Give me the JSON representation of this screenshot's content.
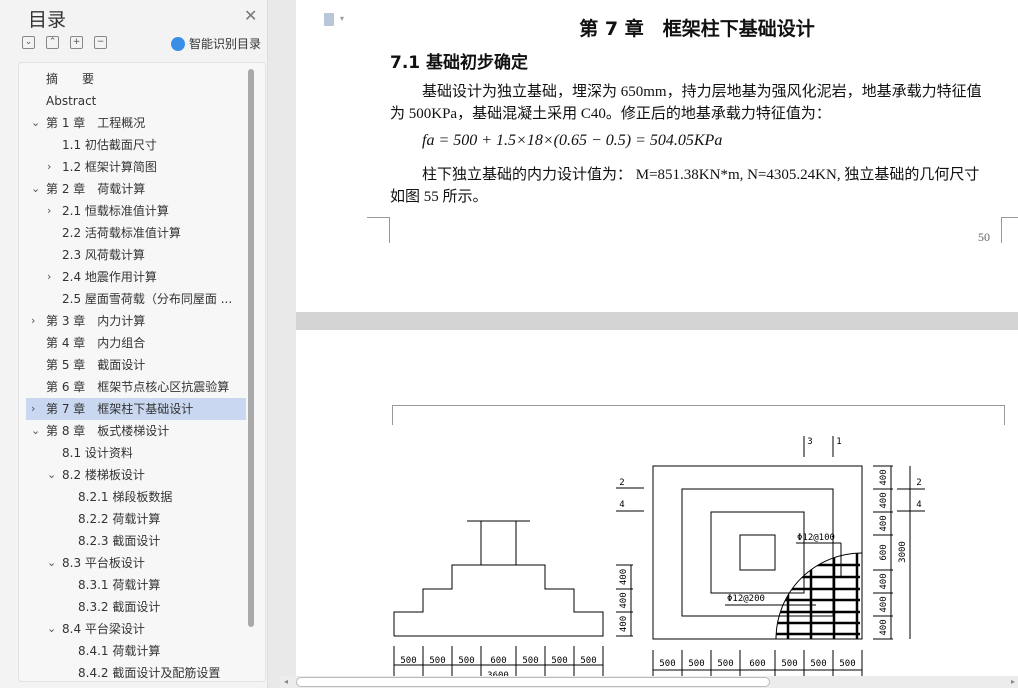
{
  "sidebar": {
    "title": "目录",
    "close": "✕",
    "tools": [
      {
        "icon": "collapse-all-icon",
        "glyph": "⌄"
      },
      {
        "icon": "expand-up-icon",
        "glyph": "⌃"
      },
      {
        "icon": "plus-icon",
        "glyph": "+"
      },
      {
        "icon": "minus-icon",
        "glyph": "−"
      }
    ],
    "smart_label": "智能识别目录",
    "items": [
      {
        "label": "摘　　要",
        "level": 0,
        "arrow": ""
      },
      {
        "label": "Abstract",
        "level": 0,
        "arrow": ""
      },
      {
        "label": "第 1 章　工程概况",
        "level": 0,
        "arrow": "⌄"
      },
      {
        "label": "1.1  初估截面尺寸",
        "level": 1,
        "arrow": ""
      },
      {
        "label": "1.2  框架计算简图",
        "level": 1,
        "arrow": "›"
      },
      {
        "label": "第 2 章　荷载计算",
        "level": 0,
        "arrow": "⌄"
      },
      {
        "label": "2.1  恒载标准值计算",
        "level": 1,
        "arrow": "›"
      },
      {
        "label": "2.2  活荷载标准值计算",
        "level": 1,
        "arrow": ""
      },
      {
        "label": "2.3  风荷载计算",
        "level": 1,
        "arrow": ""
      },
      {
        "label": "2.4 地震作用计算",
        "level": 1,
        "arrow": "›"
      },
      {
        "label": "2.5  屋面雪荷载（分布同屋面 ...",
        "level": 1,
        "arrow": ""
      },
      {
        "label": "第 3 章　内力计算",
        "level": 0,
        "arrow": "›"
      },
      {
        "label": "第 4 章　内力组合",
        "level": 0,
        "arrow": ""
      },
      {
        "label": "第 5 章　截面设计",
        "level": 0,
        "arrow": ""
      },
      {
        "label": "第 6 章　框架节点核心区抗震验算",
        "level": 0,
        "arrow": ""
      },
      {
        "label": "第 7 章　框架柱下基础设计",
        "level": 0,
        "arrow": "›",
        "selected": true
      },
      {
        "label": "第 8 章　板式楼梯设计",
        "level": 0,
        "arrow": "⌄"
      },
      {
        "label": "8.1 设计资料",
        "level": 1,
        "arrow": ""
      },
      {
        "label": "8.2 楼梯板设计",
        "level": 1,
        "arrow": "⌄"
      },
      {
        "label": "8.2.1 梯段板数据",
        "level": 2,
        "arrow": ""
      },
      {
        "label": "8.2.2 荷载计算",
        "level": 2,
        "arrow": ""
      },
      {
        "label": "8.2.3 截面设计",
        "level": 2,
        "arrow": ""
      },
      {
        "label": "8.3 平台板设计",
        "level": 1,
        "arrow": "⌄"
      },
      {
        "label": "8.3.1 荷载计算",
        "level": 2,
        "arrow": ""
      },
      {
        "label": "8.3.2 截面设计",
        "level": 2,
        "arrow": ""
      },
      {
        "label": "8.4 平台梁设计",
        "level": 1,
        "arrow": "⌄"
      },
      {
        "label": "8.4.1 荷载计算",
        "level": 2,
        "arrow": ""
      },
      {
        "label": "8.4.2 截面设计及配筋设置",
        "level": 2,
        "arrow": ""
      }
    ]
  },
  "document": {
    "chapter_title": "第 7 章　框架柱下基础设计",
    "section_title": "7.1  基础初步确定",
    "para1_line1": "基础设计为独立基础，埋深为 650mm，持力层地基为强风化泥岩，地基承载力特征值",
    "para1_line2": "为 500KPa，基础混凝土采用 C40。修正后的地基承载力特征值为：",
    "formula": "fa = 500 + 1.5×18×(0.65 − 0.5) = 504.05KPa",
    "para2_line1": "柱下独立基础的内力设计值为： M=851.38KN*m, N=4305.24KN, 独立基础的几何尺寸",
    "para2_line2": "如图 55 所示。",
    "page_number": "50"
  },
  "drawing": {
    "elev_widths": [
      "500",
      "500",
      "500",
      "600",
      "500",
      "500",
      "500"
    ],
    "elev_total": "3600",
    "elev_heights": [
      "400",
      "400",
      "400"
    ],
    "plan_widths": [
      "500",
      "500",
      "500",
      "600",
      "500",
      "500",
      "500"
    ],
    "plan_heights": [
      "400",
      "400",
      "400",
      "600",
      "400",
      "400",
      "400"
    ],
    "plan_total": "3000",
    "section_marks_top": [
      "3",
      "1"
    ],
    "section_marks_side": [
      "2",
      "4"
    ],
    "rebar1": "Φ12@100",
    "rebar2": "Φ12@200"
  }
}
